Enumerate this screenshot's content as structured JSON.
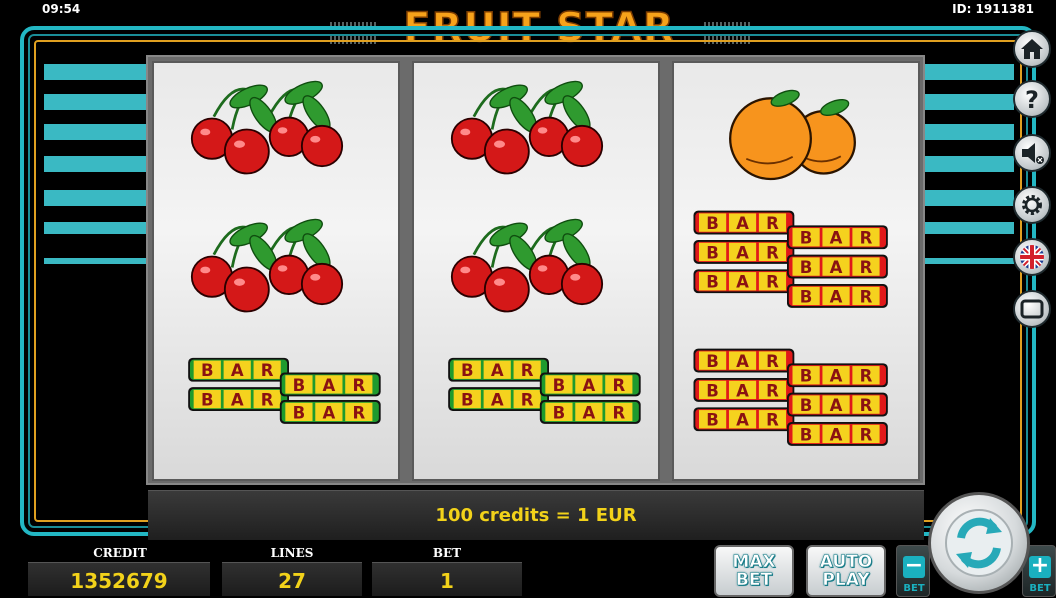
{
  "header": {
    "clock": "09:54",
    "title": "FRUIT STAR",
    "game_id": "ID: 1911381"
  },
  "reels": [
    [
      "cherries",
      "cherries",
      "bar-green"
    ],
    [
      "cherries",
      "cherries",
      "bar-green"
    ],
    [
      "oranges",
      "bar-red",
      "bar-red"
    ]
  ],
  "bar_text": "BAR",
  "credit_info": "100 credits = 1 EUR",
  "stats": {
    "credit_label": "CREDIT",
    "credit_value": "1352679",
    "lines_label": "LINES",
    "lines_value": "27",
    "bet_label": "BET",
    "bet_value": "1"
  },
  "buttons": {
    "max_bet_line1": "MAX",
    "max_bet_line2": "BET",
    "auto_play_line1": "AUTO",
    "auto_play_line2": "PLAY",
    "bet_minus_label": "BET",
    "bet_plus_label": "BET",
    "bet_minus_sign": "−",
    "bet_plus_sign": "+"
  },
  "side_menu": [
    "home-icon",
    "help-icon",
    "sound-muted-icon",
    "settings-icon",
    "language-uk-flag-icon",
    "screen-icon"
  ],
  "colors": {
    "accent": "#23b7c4",
    "title": "#f7a21a",
    "value_text": "#f2d21a",
    "bar_green": "#1f9a2e",
    "bar_red": "#e01919"
  }
}
